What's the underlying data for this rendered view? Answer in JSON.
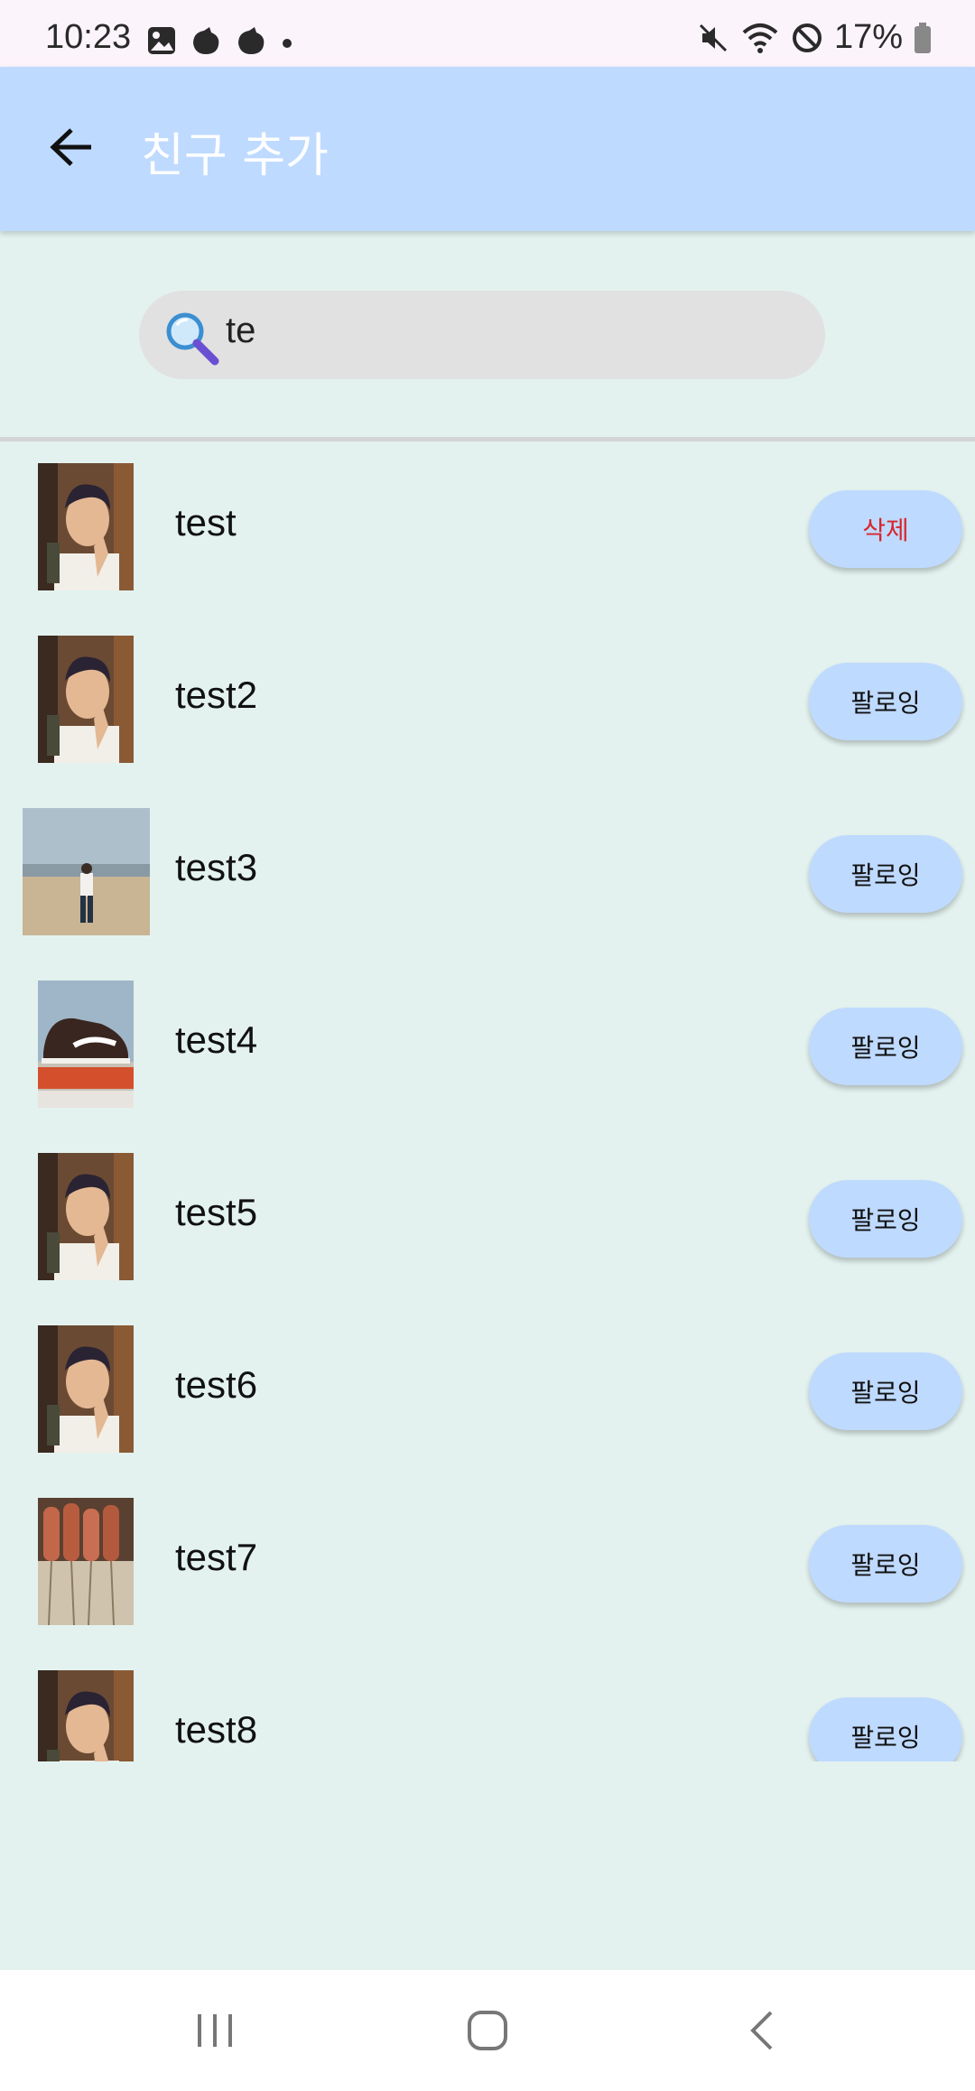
{
  "status_bar": {
    "time": "10:23",
    "battery": "17%"
  },
  "app_bar": {
    "title": "친구 추가"
  },
  "search": {
    "value": "te",
    "placeholder": ""
  },
  "users": [
    {
      "name": "test",
      "action": "삭제",
      "action_type": "delete",
      "avatar": "selfie"
    },
    {
      "name": "test2",
      "action": "팔로잉",
      "action_type": "following",
      "avatar": "selfie"
    },
    {
      "name": "test3",
      "action": "팔로잉",
      "action_type": "following",
      "avatar": "beach"
    },
    {
      "name": "test4",
      "action": "팔로잉",
      "action_type": "following",
      "avatar": "sneaker"
    },
    {
      "name": "test5",
      "action": "팔로잉",
      "action_type": "following",
      "avatar": "selfie"
    },
    {
      "name": "test6",
      "action": "팔로잉",
      "action_type": "following",
      "avatar": "selfie"
    },
    {
      "name": "test7",
      "action": "팔로잉",
      "action_type": "following",
      "avatar": "skewers"
    },
    {
      "name": "test8",
      "action": "팔로잉",
      "action_type": "following",
      "avatar": "selfie"
    }
  ],
  "colors": {
    "app_bar": "#bfdaff",
    "background": "#e3f2ef",
    "delete_text": "#d7262c"
  }
}
